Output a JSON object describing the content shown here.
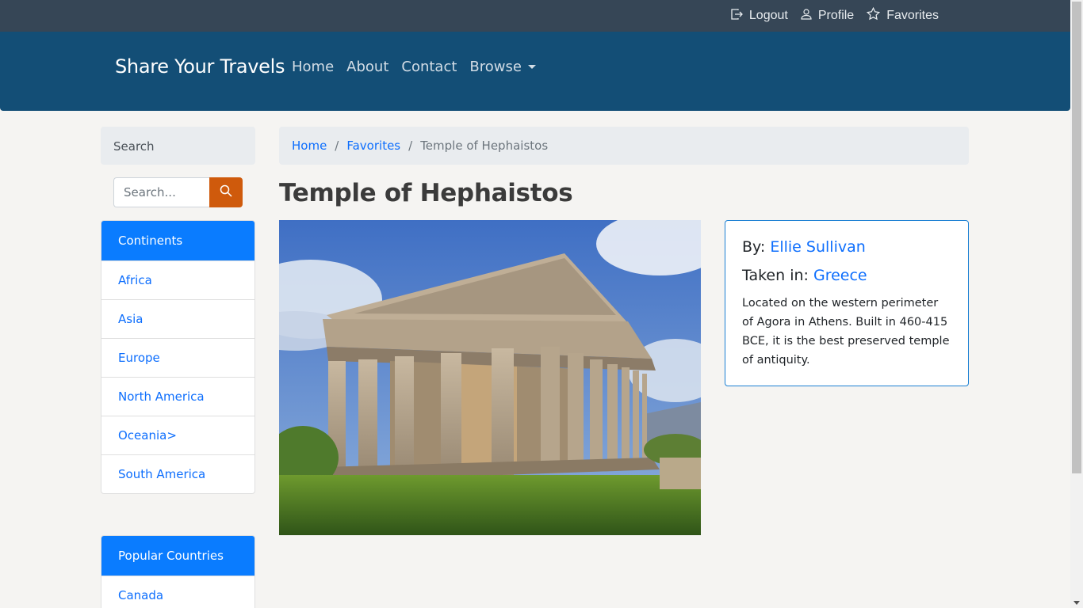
{
  "topbar": {
    "links": [
      {
        "label": "Logout",
        "icon": "logout-icon"
      },
      {
        "label": "Profile",
        "icon": "user-icon"
      },
      {
        "label": "Favorites",
        "icon": "star-icon"
      }
    ]
  },
  "navbar": {
    "brand": "Share Your Travels",
    "links": [
      "Home",
      "About",
      "Contact",
      "Browse"
    ]
  },
  "sidebar": {
    "search_header": "Search",
    "search_placeholder": "Search...",
    "continents": {
      "header": "Continents",
      "items": [
        "Africa",
        "Asia",
        "Europe",
        "North America",
        "Oceania>",
        "South America"
      ]
    },
    "countries": {
      "header": "Popular Countries",
      "items": [
        "Canada"
      ]
    }
  },
  "breadcrumb": {
    "home": "Home",
    "favorites": "Favorites",
    "current": "Temple of Hephaistos",
    "separator": "/"
  },
  "photo": {
    "title": "Temple of Hephaistos",
    "by_label": "By:",
    "author": "Ellie Sullivan",
    "taken_label": "Taken in:",
    "country": "Greece",
    "description": "Located on the western perimeter of Agora in Athens. Built in 460-415 BCE, it is the best preserved temple of antiquity."
  },
  "colors": {
    "topbar": "#364656",
    "navbar": "#134e76",
    "accent_blue": "#0a7cff",
    "search_button": "#cf5a0c",
    "link": "#0d6efd"
  }
}
